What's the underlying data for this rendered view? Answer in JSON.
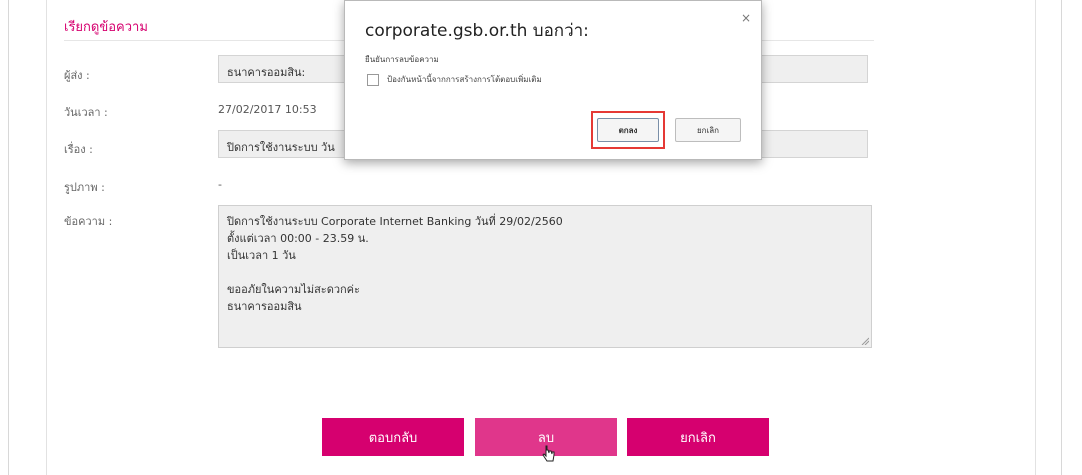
{
  "page": {
    "title": "เรียกดูข้อความ"
  },
  "form": {
    "sender_label": "ผู้ส่ง :",
    "sender_value": "ธนาคารออมสิน:",
    "datetime_label": "วันเวลา :",
    "datetime_value": "27/02/2017 10:53",
    "subject_label": "เรื่อง :",
    "subject_value": "ปิดการใช้งานระบบ วัน",
    "image_label": "รูปภาพ :",
    "image_value": "-",
    "message_label": "ข้อความ :",
    "message_lines": [
      "ปิดการใช้งานระบบ Corporate Internet Banking  วันที่ 29/02/2560",
      "ตั้งแต่เวลา 00:00 - 23.59 น.",
      "เป็นเวลา 1 วัน",
      "",
      "ขออภัยในความไม่สะดวกค่ะ",
      "ธนาคารออมสิน"
    ]
  },
  "actions": {
    "reply_label": "ตอบกลับ",
    "delete_label": "ลบ",
    "cancel_label": "ยกเลิก"
  },
  "dialog": {
    "title": "corporate.gsb.or.th  บอกว่า:",
    "close_glyph": "×",
    "message": "ยืนยันการลบข้อความ",
    "checkbox_label": "ป้องกันหน้านี้จากการสร้างการโต้ตอบเพิ่มเติม",
    "ok_label": "ตกลง",
    "cancel_label": "ยกเลิก"
  },
  "colors": {
    "accent": "#d6006f",
    "highlight_box": "#e53935"
  },
  "icons": {
    "cursor": "hand-pointer-icon",
    "close": "close-icon",
    "resize": "resize-grip-icon"
  }
}
